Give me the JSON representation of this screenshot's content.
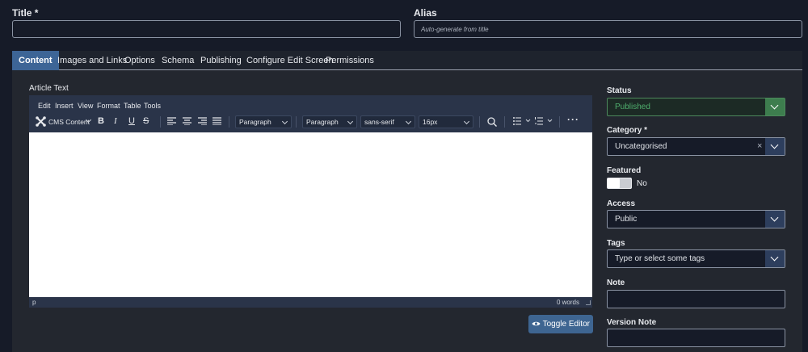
{
  "title": {
    "label": "Title *",
    "value": ""
  },
  "alias": {
    "label": "Alias",
    "placeholder": "Auto-generate from title"
  },
  "tabs": [
    "Content",
    "Images and Links",
    "Options",
    "Schema",
    "Publishing",
    "Configure Edit Screen",
    "Permissions"
  ],
  "editor": {
    "label": "Article Text",
    "menu": [
      "Edit",
      "Insert",
      "View",
      "Format",
      "Table",
      "Tools"
    ],
    "cms_content": "CMS Content",
    "format1": "Paragraph",
    "format2": "Paragraph",
    "font": "sans-serif",
    "size": "16px",
    "path": "p",
    "word_count": "0 words",
    "toggle_label": "Toggle Editor"
  },
  "sidebar": {
    "status": {
      "label": "Status",
      "value": "Published"
    },
    "category": {
      "label": "Category *",
      "value": "Uncategorised",
      "clear": "×"
    },
    "featured": {
      "label": "Featured",
      "value": "No"
    },
    "access": {
      "label": "Access",
      "value": "Public"
    },
    "tags": {
      "label": "Tags",
      "placeholder": "Type or select some tags"
    },
    "note": {
      "label": "Note",
      "value": ""
    },
    "version_note": {
      "label": "Version Note",
      "value": ""
    }
  },
  "colors": {
    "background": "#161b28",
    "panel": "#23272f",
    "accent": "#3d6596",
    "success": "#3d7d4e"
  }
}
